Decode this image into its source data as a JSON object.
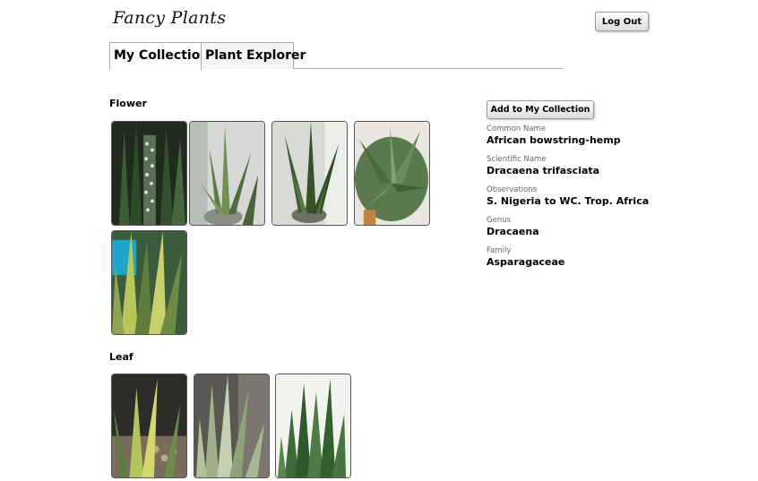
{
  "header": {
    "logo_text": "Fancy Plants",
    "logout_label": "Log Out"
  },
  "tabs": [
    {
      "label": "My Collection",
      "active": true
    },
    {
      "label": "Plant Explorer",
      "active": false
    }
  ],
  "sections": [
    {
      "title": "Flower",
      "photo_count": 5
    },
    {
      "title": "Leaf",
      "photo_count": 3
    }
  ],
  "details_panel": {
    "add_button_label": "Add to My Collection",
    "fields": [
      {
        "label": "Common Name",
        "value": "African bowstring-hemp"
      },
      {
        "label": "Scientific Name",
        "value": "Dracaena trifasciata"
      },
      {
        "label": "Observations",
        "value": "S. Nigeria to WC. Trop. Africa"
      },
      {
        "label": "Genus",
        "value": "Dracaena"
      },
      {
        "label": "Family",
        "value": "Asparagaceae"
      }
    ]
  }
}
